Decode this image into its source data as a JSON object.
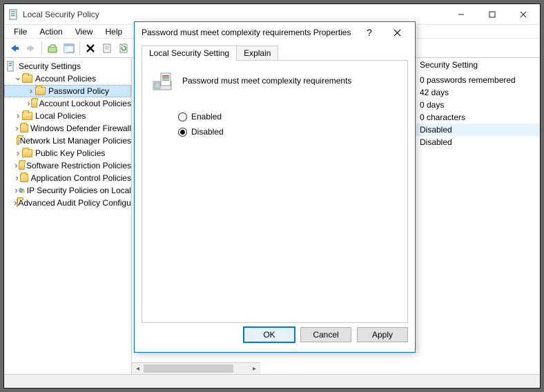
{
  "window": {
    "title": "Local Security Policy"
  },
  "menu": [
    "File",
    "Action",
    "View",
    "Help"
  ],
  "tree": {
    "root": "Security Settings",
    "items": [
      {
        "label": "Account Policies",
        "expanded": true,
        "children": [
          {
            "label": "Password Policy",
            "selected": true
          },
          {
            "label": "Account Lockout Policies"
          }
        ]
      },
      {
        "label": "Local Policies"
      },
      {
        "label": "Windows Defender Firewall"
      },
      {
        "label": "Network List Manager Policies"
      },
      {
        "label": "Public Key Policies"
      },
      {
        "label": "Software Restriction Policies"
      },
      {
        "label": "Application Control Policies"
      },
      {
        "label": "IP Security Policies on Local",
        "icon": "ipsec"
      },
      {
        "label": "Advanced Audit Policy Configuration"
      }
    ]
  },
  "list": {
    "header": "Security Setting",
    "values": [
      "0 passwords remembered",
      "42 days",
      "0 days",
      "0 characters",
      "Disabled",
      "Disabled"
    ],
    "selected_index": 4
  },
  "dialog": {
    "title": "Password must meet complexity requirements Properties",
    "tabs": [
      "Local Security Setting",
      "Explain"
    ],
    "active_tab": 0,
    "policy_name": "Password must meet complexity requirements",
    "options": {
      "enabled": "Enabled",
      "disabled": "Disabled"
    },
    "selected": "disabled",
    "buttons": {
      "ok": "OK",
      "cancel": "Cancel",
      "apply": "Apply"
    }
  }
}
